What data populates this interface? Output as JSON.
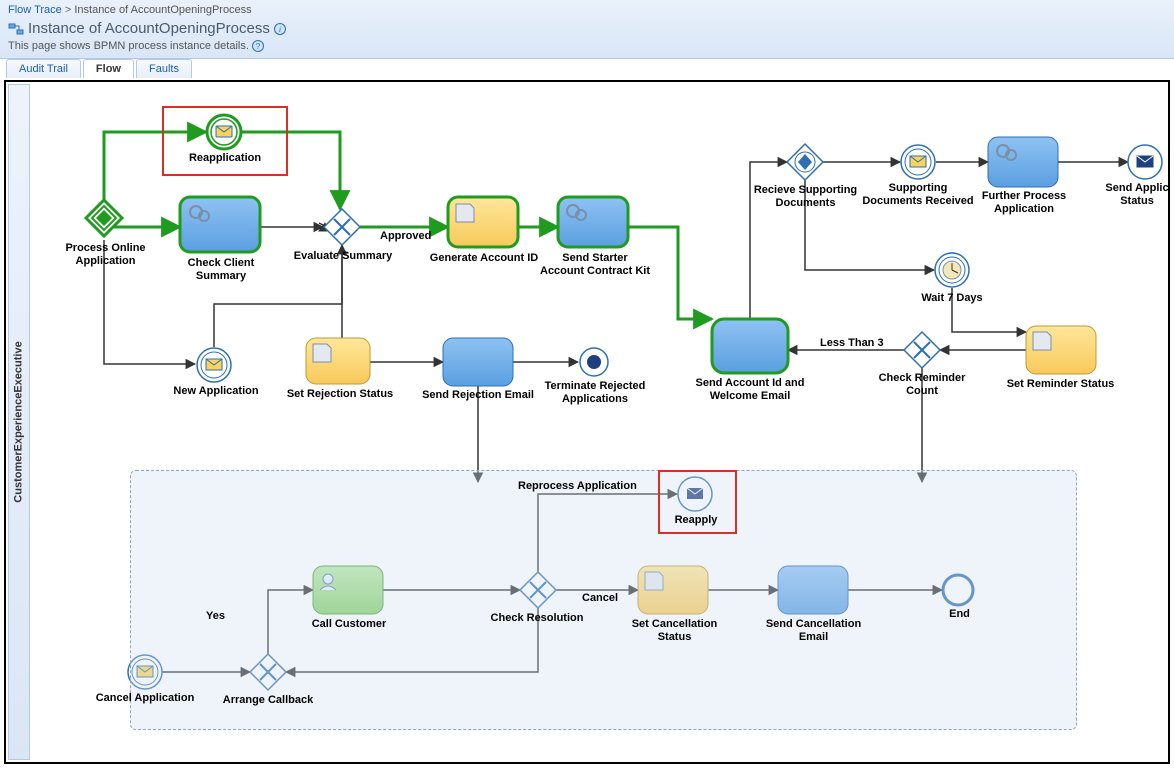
{
  "breadcrumb": {
    "parent": "Flow Trace",
    "current": "Instance of AccountOpeningProcess"
  },
  "title": "Instance of AccountOpeningProcess",
  "description": "This page shows BPMN process instance details.",
  "tabs": {
    "audit": "Audit Trail",
    "flow": "Flow",
    "faults": "Faults"
  },
  "lane": "CustomerExperienceExecutive",
  "edges": {
    "approved": "Approved",
    "lessThan3": "Less Than 3",
    "reprocess": "Reprocess Application",
    "cancel": "Cancel",
    "yes": "Yes"
  },
  "nodes": {
    "reapplication": "Reapplication",
    "processOnline": "Process Online Application",
    "checkClient": "Check Client Summary",
    "evaluateSummary": "Evaluate Summary",
    "generateAccount": "Generate Account ID",
    "sendStarter": "Send Starter Account Contract Kit",
    "recvSupporting": "Recieve Supporting Documents",
    "supportingReceived": "Supporting Documents Received",
    "furtherProcess": "Further Process Application",
    "sendApplicStatus": "Send Applic Status",
    "newApplication": "New Application",
    "setRejection": "Set Rejection Status",
    "sendRejectionEmail": "Send Rejection Email",
    "terminateRejected": "Terminate Rejected Applications",
    "sendAccountWelcome": "Send Account Id and Welcome Email",
    "wait7": "Wait 7 Days",
    "checkReminder": "Check Reminder Count",
    "setReminder": "Set Reminder Status",
    "reapply": "Reapply",
    "callCustomer": "Call Customer",
    "checkResolution": "Check Resolution",
    "setCancellation": "Set Cancellation Status",
    "sendCancellation": "Send Cancellation Email",
    "end": "End",
    "cancelApplication": "Cancel Application",
    "arrangeCallback": "Arrange Callback"
  }
}
